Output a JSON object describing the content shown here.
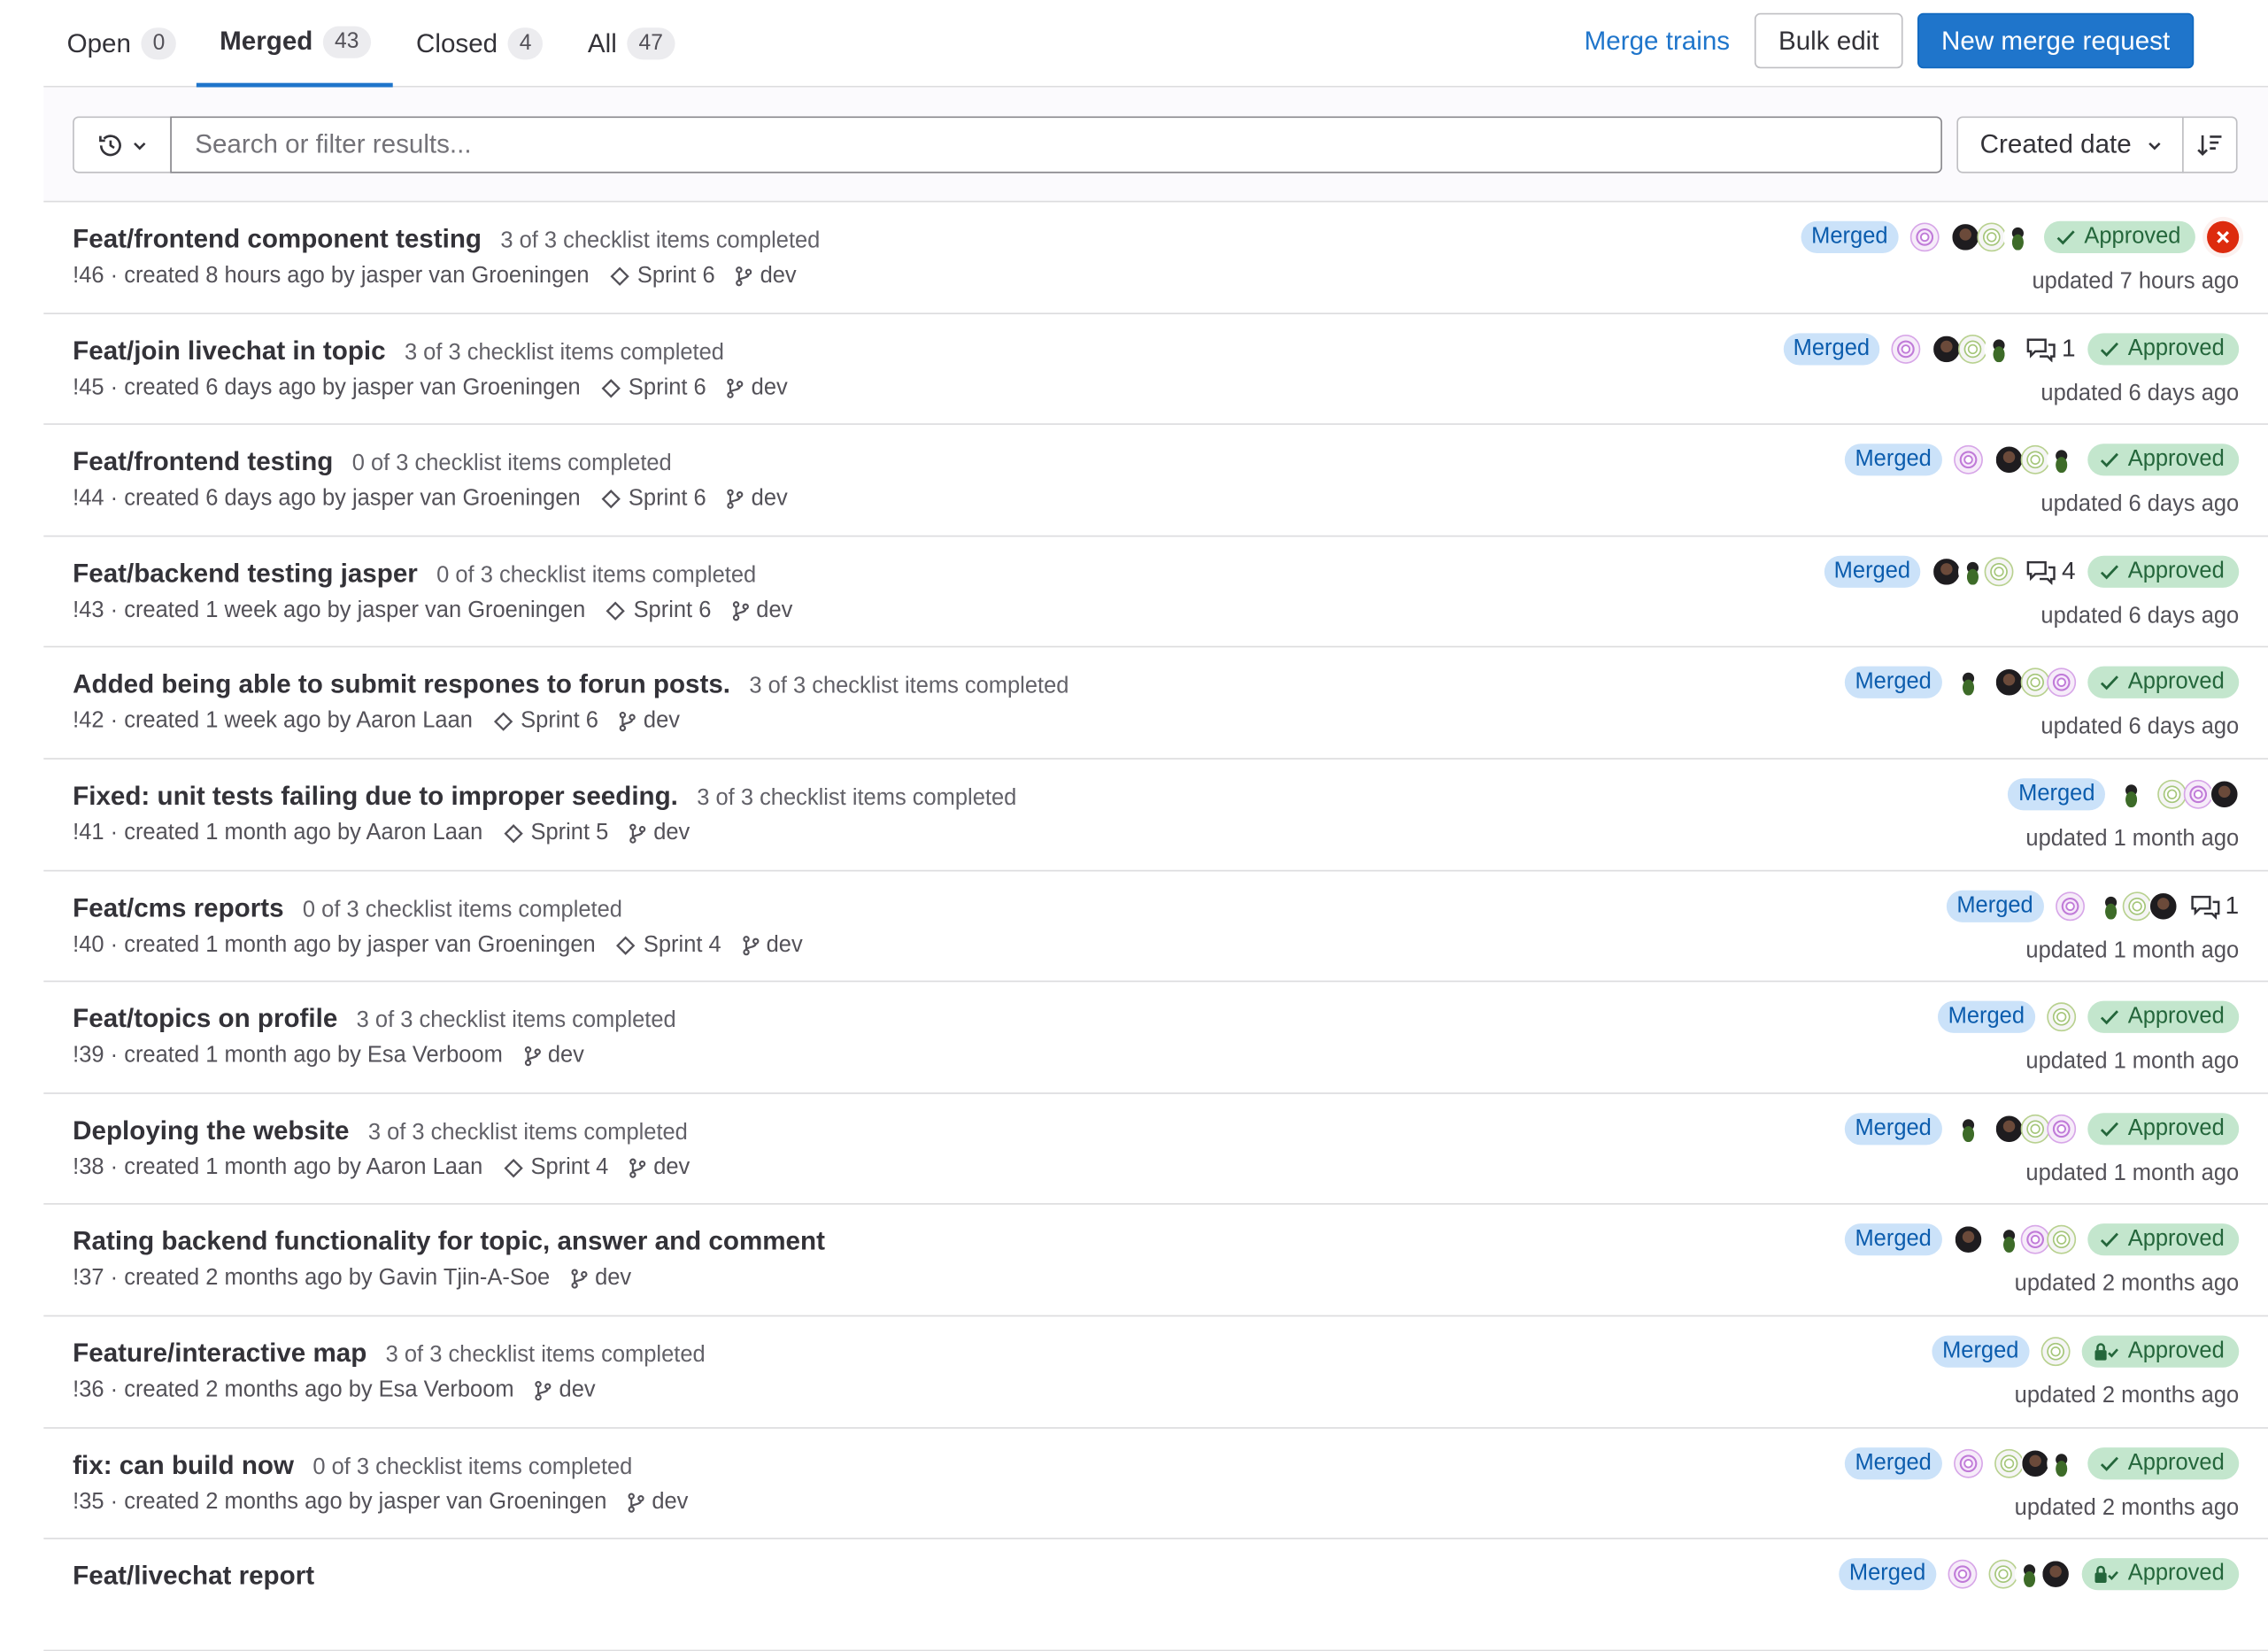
{
  "tabs": [
    {
      "label": "Open",
      "count": "0"
    },
    {
      "label": "Merged",
      "count": "43"
    },
    {
      "label": "Closed",
      "count": "4"
    },
    {
      "label": "All",
      "count": "47"
    }
  ],
  "header": {
    "merge_trains": "Merge trains",
    "bulk_edit": "Bulk edit",
    "new_merge_request": "New merge request"
  },
  "filter": {
    "search_placeholder": "Search or filter results...",
    "sort_label": "Created date"
  },
  "merge_requests": [
    {
      "title": "Feat/frontend component testing",
      "checklist": "3 of 3 checklist items completed",
      "meta": "!46 · created 8 hours ago by jasper van Groeningen",
      "milestone": "Sprint 6",
      "branch": "dev",
      "status": "Merged",
      "comments": "",
      "approved": "Approved",
      "updated": "updated 7 hours ago"
    },
    {
      "title": "Feat/join livechat in topic",
      "checklist": "3 of 3 checklist items completed",
      "meta": "!45 · created 6 days ago by jasper van Groeningen",
      "milestone": "Sprint 6",
      "branch": "dev",
      "status": "Merged",
      "comments": "1",
      "approved": "Approved",
      "updated": "updated 6 days ago"
    },
    {
      "title": "Feat/frontend testing",
      "checklist": "0 of 3 checklist items completed",
      "meta": "!44 · created 6 days ago by jasper van Groeningen",
      "milestone": "Sprint 6",
      "branch": "dev",
      "status": "Merged",
      "comments": "",
      "approved": "Approved",
      "updated": "updated 6 days ago"
    },
    {
      "title": "Feat/backend testing jasper",
      "checklist": "0 of 3 checklist items completed",
      "meta": "!43 · created 1 week ago by jasper van Groeningen",
      "milestone": "Sprint 6",
      "branch": "dev",
      "status": "Merged",
      "comments": "4",
      "approved": "Approved",
      "updated": "updated 6 days ago"
    },
    {
      "title": "Added being able to submit respones to forun posts.",
      "checklist": "3 of 3 checklist items completed",
      "meta": "!42 · created 1 week ago by Aaron Laan",
      "milestone": "Sprint 6",
      "branch": "dev",
      "status": "Merged",
      "comments": "",
      "approved": "Approved",
      "updated": "updated 6 days ago"
    },
    {
      "title": "Fixed: unit tests failing due to improper seeding.",
      "checklist": "3 of 3 checklist items completed",
      "meta": "!41 · created 1 month ago by Aaron Laan",
      "milestone": "Sprint 5",
      "branch": "dev",
      "status": "Merged",
      "comments": "",
      "approved": "",
      "updated": "updated 1 month ago"
    },
    {
      "title": "Feat/cms reports",
      "checklist": "0 of 3 checklist items completed",
      "meta": "!40 · created 1 month ago by jasper van Groeningen",
      "milestone": "Sprint 4",
      "branch": "dev",
      "status": "Merged",
      "comments": "1",
      "approved": "",
      "updated": "updated 1 month ago"
    },
    {
      "title": "Feat/topics on profile",
      "checklist": "3 of 3 checklist items completed",
      "meta": "!39 · created 1 month ago by Esa Verboom",
      "milestone": "",
      "branch": "dev",
      "status": "Merged",
      "comments": "",
      "approved": "Approved",
      "updated": "updated 1 month ago"
    },
    {
      "title": "Deploying the website",
      "checklist": "3 of 3 checklist items completed",
      "meta": "!38 · created 1 month ago by Aaron Laan",
      "milestone": "Sprint 4",
      "branch": "dev",
      "status": "Merged",
      "comments": "",
      "approved": "Approved",
      "updated": "updated 1 month ago"
    },
    {
      "title": "Rating backend functionality for topic, answer and comment",
      "checklist": "",
      "meta": "!37 · created 2 months ago by Gavin Tjin-A-Soe",
      "milestone": "",
      "branch": "dev",
      "status": "Merged",
      "comments": "",
      "approved": "Approved",
      "updated": "updated 2 months ago"
    },
    {
      "title": "Feature/interactive map",
      "checklist": "3 of 3 checklist items completed",
      "meta": "!36 · created 2 months ago by Esa Verboom",
      "milestone": "",
      "branch": "dev",
      "status": "Merged",
      "comments": "",
      "approved": "Approved",
      "updated": "updated 2 months ago"
    },
    {
      "title": "fix: can build now",
      "checklist": "0 of 3 checklist items completed",
      "meta": "!35 · created 2 months ago by jasper van Groeningen",
      "milestone": "",
      "branch": "dev",
      "status": "Merged",
      "comments": "",
      "approved": "Approved",
      "updated": "updated 2 months ago"
    },
    {
      "title": "Feat/livechat report",
      "checklist": "",
      "meta": "",
      "milestone": "",
      "branch": "",
      "status": "Merged",
      "comments": "",
      "approved": "Approved",
      "updated": ""
    }
  ],
  "icons": {
    "history": "history-icon",
    "chevron": "chevron-down-icon",
    "sort": "sort-descending-icon",
    "milestone": "milestone-icon",
    "branch": "branch-icon",
    "comment": "comment-icon",
    "check": "check-icon",
    "failed": "pipeline-failed-icon"
  },
  "colors": {
    "accent": "#1f75cb",
    "merged_badge_bg": "#cbe2f9",
    "approved_badge_bg": "#c3e6cd",
    "failed": "#dd2b0e"
  }
}
